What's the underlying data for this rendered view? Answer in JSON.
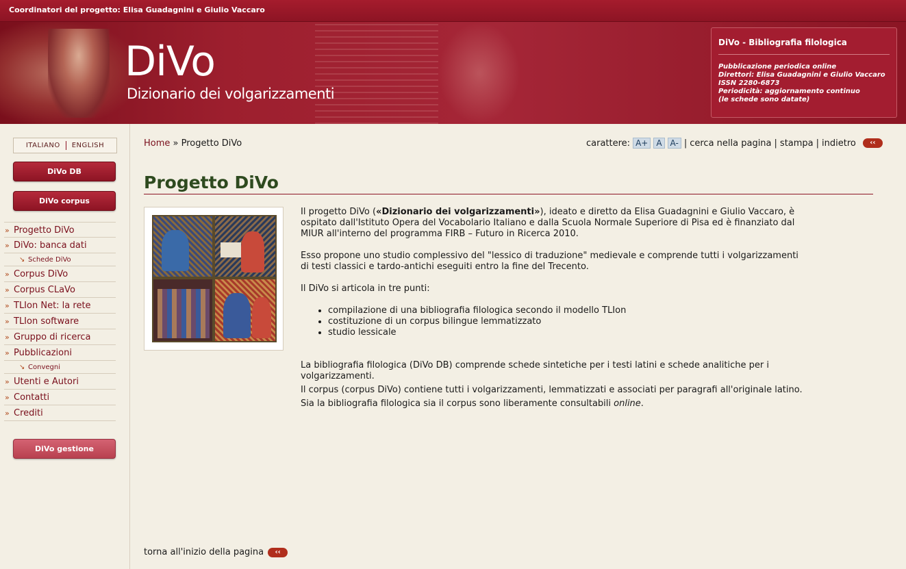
{
  "topbar": {
    "coordinators": "Coordinatori del progetto: Elisa Guadagnini e Giulio Vaccaro"
  },
  "banner": {
    "logo_title": "DiVo",
    "logo_subtitle": "Dizionario dei volgarizzamenti",
    "infobox": {
      "title": "DiVo - Bibliografia filologica",
      "lines": [
        "Pubblicazione periodica online",
        "Direttori: Elisa Guadagnini e Giulio Vaccaro",
        "ISSN 2280-6873",
        "Periodicità: aggiornamento continuo",
        "(le schede sono datate)"
      ]
    }
  },
  "sidebar": {
    "lang_it": "ITALIANO",
    "lang_en": "ENGLISH",
    "btn_db": "DiVo DB",
    "btn_corpus": "DiVo corpus",
    "btn_gestione": "DiVo gestione",
    "menu": [
      {
        "label": "Progetto DiVo"
      },
      {
        "label": "DiVo: banca dati"
      },
      {
        "label": "Schede DiVo",
        "sub": true
      },
      {
        "label": "Corpus DiVo"
      },
      {
        "label": "Corpus CLaVo"
      },
      {
        "label": "TLIon Net: la rete"
      },
      {
        "label": "TLIon software"
      },
      {
        "label": "Gruppo di ricerca"
      },
      {
        "label": "Pubblicazioni"
      },
      {
        "label": "Convegni",
        "sub": true
      },
      {
        "label": "Utenti e Autori"
      },
      {
        "label": "Contatti"
      },
      {
        "label": "Crediti"
      }
    ]
  },
  "breadcrumb": {
    "home": "Home",
    "sep": "»",
    "current": "Progetto DiVo"
  },
  "tools": {
    "font_label": "carattere:",
    "font_up": "A+",
    "font_normal": "A",
    "font_down": "A-",
    "search": "cerca nella pagina",
    "print": "stampa",
    "back": "indietro",
    "sep": "|",
    "back_icon": "‹‹"
  },
  "main": {
    "title": "Progetto DiVo",
    "p1_pre": "Il progetto DiVo (",
    "p1_bold": "«Dizionario dei volgarizzamenti»",
    "p1_post": "), ideato e diretto da Elisa Guadagnini e Giulio Vaccaro, è ospitato dall'Istituto Opera del Vocabolario Italiano e dalla Scuola Normale Superiore di Pisa ed è finanziato dal MIUR all'interno del programma FIRB – Futuro in Ricerca 2010.",
    "p2": "Esso propone uno studio complessivo del \"lessico di traduzione\" medievale e comprende tutti i volgarizzamenti di testi classici e tardo-antichi eseguiti entro la fine del Trecento.",
    "p3": "Il DiVo si articola in tre punti:",
    "points": [
      "compilazione di una bibliografia filologica secondo il modello TLIon",
      "costituzione di un corpus bilingue lemmatizzato",
      "studio lessicale"
    ],
    "p4": "La bibliografia filologica (DiVo DB) comprende schede sintetiche per i testi latini e schede analitiche per i volgarizzamenti.",
    "p5": "Il corpus (corpus DiVo) contiene tutti i volgarizzamenti, lemmatizzati e associati per paragrafi all'originale latino.",
    "p6_pre": "Sia la bibliografia filologica sia il corpus sono liberamente consultabili ",
    "p6_em": "online",
    "p6_post": "."
  },
  "footer": {
    "totop": "torna all'inizio della pagina",
    "totop_icon": "‹‹"
  }
}
